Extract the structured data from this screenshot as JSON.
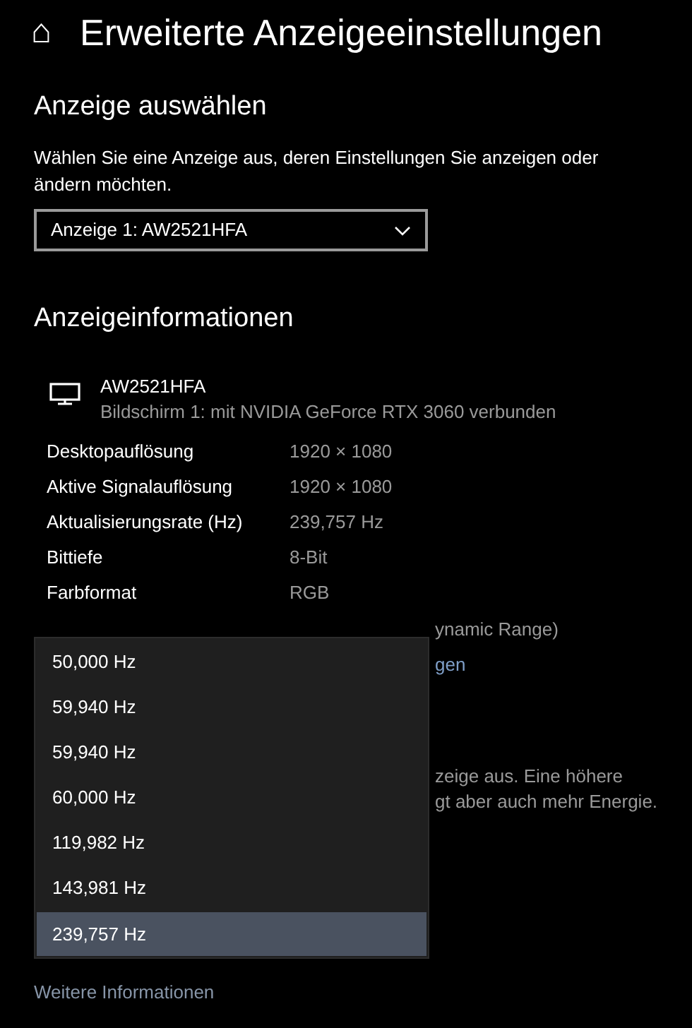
{
  "header": {
    "back_icon": "⌂",
    "title": "Erweiterte Anzeigeeinstellungen"
  },
  "select_display": {
    "heading": "Anzeige auswählen",
    "description": "Wählen Sie eine Anzeige aus, deren Einstellungen Sie anzeigen oder ändern möchten.",
    "dropdown_value": "Anzeige 1: AW2521HFA"
  },
  "display_info": {
    "heading": "Anzeigeinformationen",
    "monitor_name": "AW2521HFA",
    "monitor_subtitle": "Bildschirm 1: mit NVIDIA GeForce RTX 3060 verbunden",
    "rows": [
      {
        "label": "Desktopauflösung",
        "value": "1920 × 1080"
      },
      {
        "label": "Aktive Signalauflösung",
        "value": "1920 × 1080"
      },
      {
        "label": "Aktualisierungsrate (Hz)",
        "value": "239,757 Hz"
      },
      {
        "label": "Bittiefe",
        "value": "8-Bit"
      },
      {
        "label": "Farbformat",
        "value": "RGB"
      }
    ],
    "partial_row": "ynamic Range)",
    "partial_link": "gen"
  },
  "refresh_rate": {
    "partial_lines": [
      "zeige aus. Eine höhere",
      "gt aber auch mehr Energie."
    ]
  },
  "more_info_link": "Weitere Informationen",
  "rate_menu": [
    {
      "label": "50,000 Hz",
      "selected": false
    },
    {
      "label": "59,940 Hz",
      "selected": false
    },
    {
      "label": "59,940 Hz",
      "selected": false
    },
    {
      "label": "60,000 Hz",
      "selected": false
    },
    {
      "label": "119,982 Hz",
      "selected": false
    },
    {
      "label": "143,981 Hz",
      "selected": false
    },
    {
      "label": "239,757 Hz",
      "selected": true
    }
  ]
}
